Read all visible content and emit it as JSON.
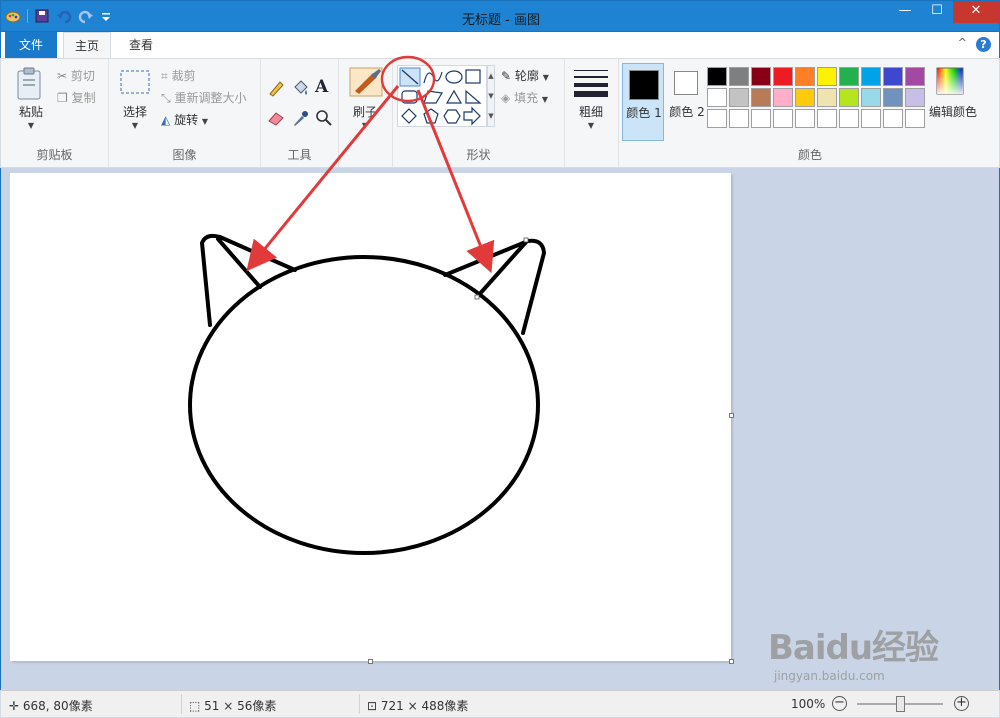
{
  "window": {
    "title": "无标题 - 画图"
  },
  "tabs": {
    "file": "文件",
    "home": "主页",
    "view": "查看"
  },
  "clipboard": {
    "paste": "粘贴",
    "cut": "剪切",
    "copy": "复制",
    "label": "剪贴板"
  },
  "image": {
    "select": "选择",
    "crop": "裁剪",
    "resize": "重新调整大小",
    "rotate": "旋转",
    "label": "图像"
  },
  "tools": {
    "label": "工具"
  },
  "brushes": {
    "label": "刷子"
  },
  "shapes": {
    "outline": "轮廓",
    "fill": "填充",
    "label": "形状",
    "selected": "line"
  },
  "size": {
    "label": "粗细"
  },
  "colors": {
    "color1_label": "颜色 1",
    "color2_label": "颜色 2",
    "color1": "#000000",
    "color2": "#ffffff",
    "edit_label": "编辑颜色",
    "label": "颜色",
    "palette": [
      "#000000",
      "#7f7f7f",
      "#880015",
      "#ed1c24",
      "#ff7f27",
      "#fff200",
      "#22b14c",
      "#00a2e8",
      "#3f48cc",
      "#a349a4",
      "#ffffff",
      "#c3c3c3",
      "#b97a57",
      "#ffaec9",
      "#ffc90e",
      "#efe4b0",
      "#b5e61d",
      "#99d9ea",
      "#7092be",
      "#c8bfe7",
      "#ffffff",
      "#ffffff",
      "#ffffff",
      "#ffffff",
      "#ffffff",
      "#ffffff",
      "#ffffff",
      "#ffffff",
      "#ffffff",
      "#ffffff"
    ]
  },
  "status": {
    "cursor": "668, 80像素",
    "selection": "51 × 56像素",
    "image_size": "721 × 488像素",
    "zoom": "100%"
  },
  "watermark": {
    "brand": "Baidu经验",
    "url": "jingyan.baidu.com"
  },
  "accent": {
    "ribbon_blue": "#1979ca",
    "annotation_red": "#e23a3a"
  }
}
